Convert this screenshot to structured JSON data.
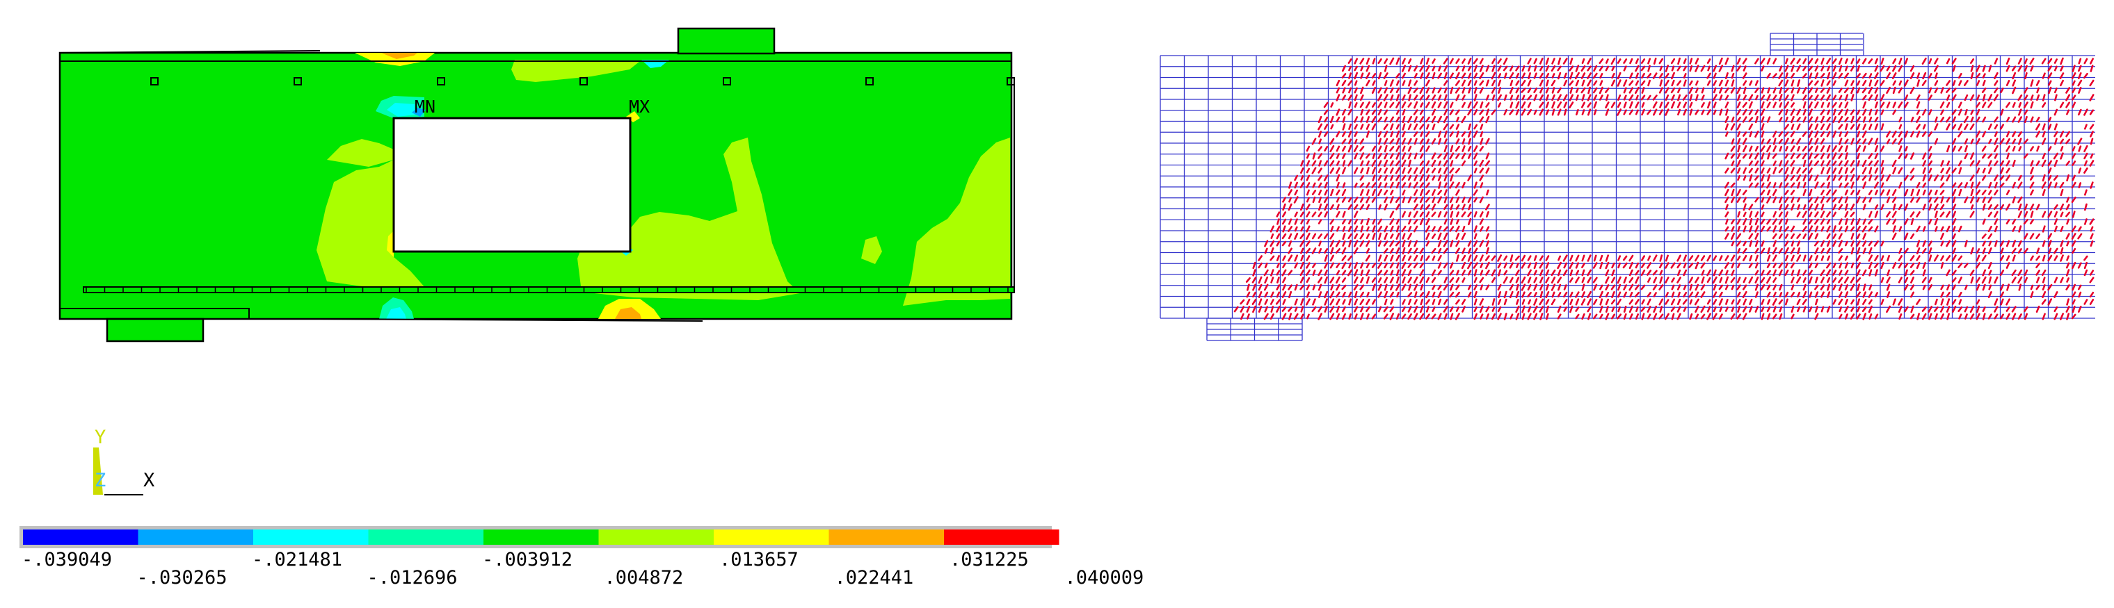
{
  "contour": {
    "min_label": "MN",
    "max_label": "MX"
  },
  "triad": {
    "y": "Y",
    "z": "Z",
    "x": "X"
  },
  "legend": {
    "labels": [
      ".039049",
      ".030265",
      ".021481",
      ".012696",
      ".003912",
      ".004872",
      ".013657",
      ".022441",
      ".031225",
      ".040009"
    ],
    "display": [
      "-.039049",
      "-.030265",
      "-.021481",
      "-.012696",
      "-.003912",
      ".004872",
      ".013657",
      ".022441",
      ".031225",
      ".040009"
    ],
    "values": [
      -0.039049,
      -0.030265,
      -0.021481,
      -0.012696,
      -0.003912,
      0.004872,
      0.013657,
      0.022441,
      0.031225,
      0.040009
    ],
    "colors": [
      "#0000ff",
      "#00a6ff",
      "#00ffff",
      "#00ffaa",
      "#00e600",
      "#aaff00",
      "#ffff00",
      "#ffaa00",
      "#ff0000"
    ]
  },
  "colors": {
    "model_green": "#00e600",
    "hole": "#ffffff",
    "mesh_blue": "#3333cc",
    "crack_red": "#e8002a",
    "triad_y": "#ccdd00",
    "triad_z": "#44bbff"
  }
}
